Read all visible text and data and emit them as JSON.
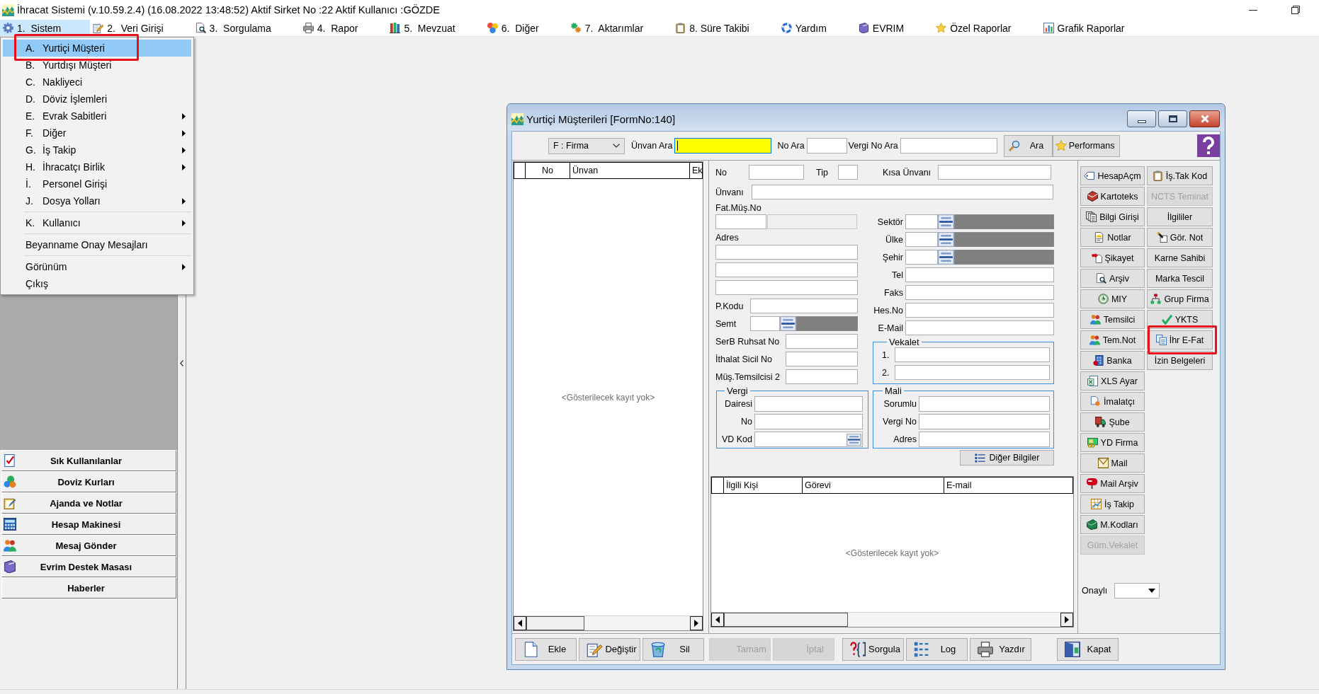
{
  "window": {
    "title": "İhracat Sistemi (v.10.59.2.4) (16.08.2022 13:48:52) Aktif Sirket No :22 Aktif Kullanıcı :GÖZDE"
  },
  "menu_bar": [
    {
      "label": "1.  Sistem",
      "selected": true
    },
    {
      "label": "2.  Veri Girişi",
      "selected": false
    },
    {
      "label": "3.  Sorgulama",
      "selected": false
    },
    {
      "label": "4.  Rapor",
      "selected": false
    },
    {
      "label": "5.  Mevzuat",
      "selected": false
    },
    {
      "label": "6.  Diğer",
      "selected": false
    },
    {
      "label": "7.  Aktarımlar",
      "selected": false
    },
    {
      "label": "8. Süre Takibi",
      "selected": false
    },
    {
      "label": "Yardım",
      "selected": false
    },
    {
      "label": "EVRIM",
      "selected": false
    },
    {
      "label": "Özel Raporlar",
      "selected": false
    },
    {
      "label": "Grafik Raporlar",
      "selected": false
    }
  ],
  "system_menu": {
    "items": [
      {
        "kind": "item",
        "key": "A.",
        "label": "Yurtiçi Müşteri",
        "submenu": false,
        "selected": true,
        "marked": true
      },
      {
        "kind": "item",
        "key": "B.",
        "label": "Yurtdışı Müşteri",
        "submenu": false,
        "selected": false,
        "marked": false
      },
      {
        "kind": "item",
        "key": "C.",
        "label": "Nakliyeci",
        "submenu": false,
        "selected": false,
        "marked": false
      },
      {
        "kind": "item",
        "key": "D.",
        "label": "Döviz İşlemleri",
        "submenu": false,
        "selected": false,
        "marked": false
      },
      {
        "kind": "item",
        "key": "E.",
        "label": "Evrak Sabitleri",
        "submenu": true,
        "selected": false,
        "marked": false
      },
      {
        "kind": "item",
        "key": "F.",
        "label": "Diğer",
        "submenu": true,
        "selected": false,
        "marked": false
      },
      {
        "kind": "item",
        "key": "G.",
        "label": "İş Takip",
        "submenu": true,
        "selected": false,
        "marked": false
      },
      {
        "kind": "item",
        "key": "H.",
        "label": "İhracatçı Birlik",
        "submenu": true,
        "selected": false,
        "marked": false
      },
      {
        "kind": "item",
        "key": "İ.",
        "label": "Personel Girişi",
        "submenu": false,
        "selected": false,
        "marked": false
      },
      {
        "kind": "item",
        "key": "J.",
        "label": "Dosya Yolları",
        "submenu": true,
        "selected": false,
        "marked": false
      },
      {
        "kind": "separator"
      },
      {
        "kind": "item",
        "key": "K.",
        "label": "Kullanıcı",
        "submenu": true,
        "selected": false,
        "marked": false
      },
      {
        "kind": "separator"
      },
      {
        "kind": "item",
        "label": "Beyanname Onay Mesajları",
        "submenu": false,
        "selected": false,
        "marked": false
      },
      {
        "kind": "separator"
      },
      {
        "kind": "item",
        "label": "Görünüm",
        "submenu": true,
        "selected": false,
        "marked": false
      },
      {
        "kind": "item",
        "label": "Çıkış",
        "submenu": false,
        "selected": false,
        "marked": false
      }
    ]
  },
  "sidebar": {
    "shortcuts": [
      {
        "label": "Sık Kullanılanlar"
      },
      {
        "label": "Doviz Kurları"
      },
      {
        "label": "Ajanda ve Notlar"
      },
      {
        "label": "Hesap Makinesi"
      },
      {
        "label": "Mesaj Gönder"
      },
      {
        "label": "Evrim Destek Masası"
      },
      {
        "label": "Haberler"
      }
    ]
  },
  "dialog": {
    "title": "Yurtiçi Müşterileri [FormNo:140]",
    "search_bar": {
      "type": "F : Firma",
      "fields": [
        {
          "label": "Ünvan Ara",
          "focused": true
        },
        {
          "label": "No Ara",
          "focused": false
        },
        {
          "label": "Vergi No Ara",
          "focused": false
        }
      ],
      "buttons": [
        {
          "label": "Ara"
        },
        {
          "label": "Performans"
        }
      ]
    },
    "customer_list": {
      "columns": [
        "No",
        "Ünvan",
        "Ek"
      ],
      "empty_text": "<Gösterilecek kayıt yok>"
    },
    "form": {
      "code": {
        "label": "No"
      },
      "type": {
        "label": "Tip"
      },
      "short_title": {
        "label": "Kısa Ünvanı"
      },
      "title": {
        "label": "Ünvanı"
      },
      "invoice_customer_no": {
        "label": "Fat.Müş.No"
      },
      "address": {
        "label": "Adres"
      },
      "left_fields": [
        {
          "label": "P.Kodu",
          "kind": "text"
        },
        {
          "label": "Semt",
          "kind": "lookup"
        },
        {
          "label": "SerB Ruhsat No",
          "kind": "text"
        },
        {
          "label": "İthalat Sicil No",
          "kind": "text"
        },
        {
          "label": "Müş.Temsilcisi 2",
          "kind": "text"
        }
      ],
      "right_fields": [
        {
          "label": "Sektör",
          "kind": "lookup"
        },
        {
          "label": "Ülke",
          "kind": "lookup"
        },
        {
          "label": "Şehir",
          "kind": "lookup"
        },
        {
          "label": "Tel",
          "kind": "text"
        },
        {
          "label": "Faks",
          "kind": "text"
        },
        {
          "label": "Hes.No",
          "kind": "text"
        },
        {
          "label": "E-Mail",
          "kind": "text"
        }
      ],
      "power_of_attorney": {
        "title": "Vekalet",
        "fields": [
          {
            "label": "1.",
            "kind": "text"
          },
          {
            "label": "2.",
            "kind": "text"
          }
        ]
      },
      "tax": {
        "title": "Vergi",
        "fields": [
          {
            "label": "Dairesi",
            "kind": "text"
          },
          {
            "label": "No",
            "kind": "text"
          },
          {
            "label": "VD Kod",
            "kind": "picker"
          }
        ]
      },
      "fiscal": {
        "title": "Mali",
        "fields": [
          {
            "label": "Sorumlu",
            "kind": "text"
          },
          {
            "label": "Vergi No",
            "kind": "text"
          },
          {
            "label": "Adres",
            "kind": "text"
          }
        ]
      },
      "more_button": {
        "label": "Diğer Bilgiler"
      }
    },
    "contacts": {
      "columns": [
        "İlgili Kişi",
        "Görevi",
        "E-mail"
      ],
      "empty_text": "<Gösterilecek kayıt yok>"
    },
    "side_buttons": {
      "column_1": [
        {
          "label": "HesapAçm",
          "disabled": false,
          "marked": false
        },
        {
          "label": "Kartoteks",
          "disabled": false,
          "marked": false
        },
        {
          "label": "Bilgi Girişi",
          "disabled": false,
          "marked": false
        },
        {
          "label": "Notlar",
          "disabled": false,
          "marked": false
        },
        {
          "label": "Şikayet",
          "disabled": false,
          "marked": false
        },
        {
          "label": "Arşiv",
          "disabled": false,
          "marked": false
        },
        {
          "label": "MIY",
          "disabled": false,
          "marked": false
        },
        {
          "label": "Temsilci",
          "disabled": false,
          "marked": false
        },
        {
          "label": "Tem.Not",
          "disabled": false,
          "marked": false
        },
        {
          "label": "Banka",
          "disabled": false,
          "marked": false
        },
        {
          "label": "XLS Ayar",
          "disabled": false,
          "marked": false
        },
        {
          "label": "İmalatçı",
          "disabled": false,
          "marked": false
        },
        {
          "label": "Şube",
          "disabled": false,
          "marked": false
        },
        {
          "label": "YD Firma",
          "disabled": false,
          "marked": false
        },
        {
          "label": "Mail",
          "disabled": false,
          "marked": false
        },
        {
          "label": "Mail Arşiv",
          "disabled": false,
          "marked": false
        },
        {
          "label": "İş Takip",
          "disabled": false,
          "marked": false
        },
        {
          "label": "M.Kodları",
          "disabled": false,
          "marked": false
        },
        {
          "label": "Güm.Vekalet",
          "disabled": true,
          "marked": false
        }
      ],
      "column_2": [
        {
          "label": "İş.Tak Kod",
          "disabled": false,
          "marked": false
        },
        {
          "label": "NCTS Teminat",
          "disabled": true,
          "marked": false
        },
        {
          "label": "İlgililer",
          "disabled": false,
          "marked": false
        },
        {
          "label": "Gör. Not",
          "disabled": false,
          "marked": false
        },
        {
          "label": "Karne Sahibi",
          "disabled": false,
          "marked": false
        },
        {
          "label": "Marka Tescil",
          "disabled": false,
          "marked": false
        },
        {
          "label": "Grup Firma",
          "disabled": false,
          "marked": false
        },
        {
          "label": "YKTS",
          "disabled": false,
          "marked": false
        },
        {
          "label": "İhr E-Fat",
          "disabled": false,
          "marked": true
        },
        {
          "label": "İzin Belgeleri",
          "disabled": false,
          "marked": false
        }
      ]
    },
    "approved": {
      "label": "Onaylı"
    },
    "action_buttons": [
      {
        "label": "Ekle",
        "disabled": false
      },
      {
        "label": "Değiştir",
        "disabled": false
      },
      {
        "label": "Sil",
        "disabled": false
      },
      {
        "label": "Tamam",
        "disabled": true
      },
      {
        "label": "İptal",
        "disabled": true
      },
      {
        "label": "Sorgula",
        "disabled": false
      },
      {
        "label": "Log",
        "disabled": false
      },
      {
        "label": "Yazdır",
        "disabled": false
      },
      {
        "label": "Kapat",
        "disabled": false
      }
    ]
  }
}
